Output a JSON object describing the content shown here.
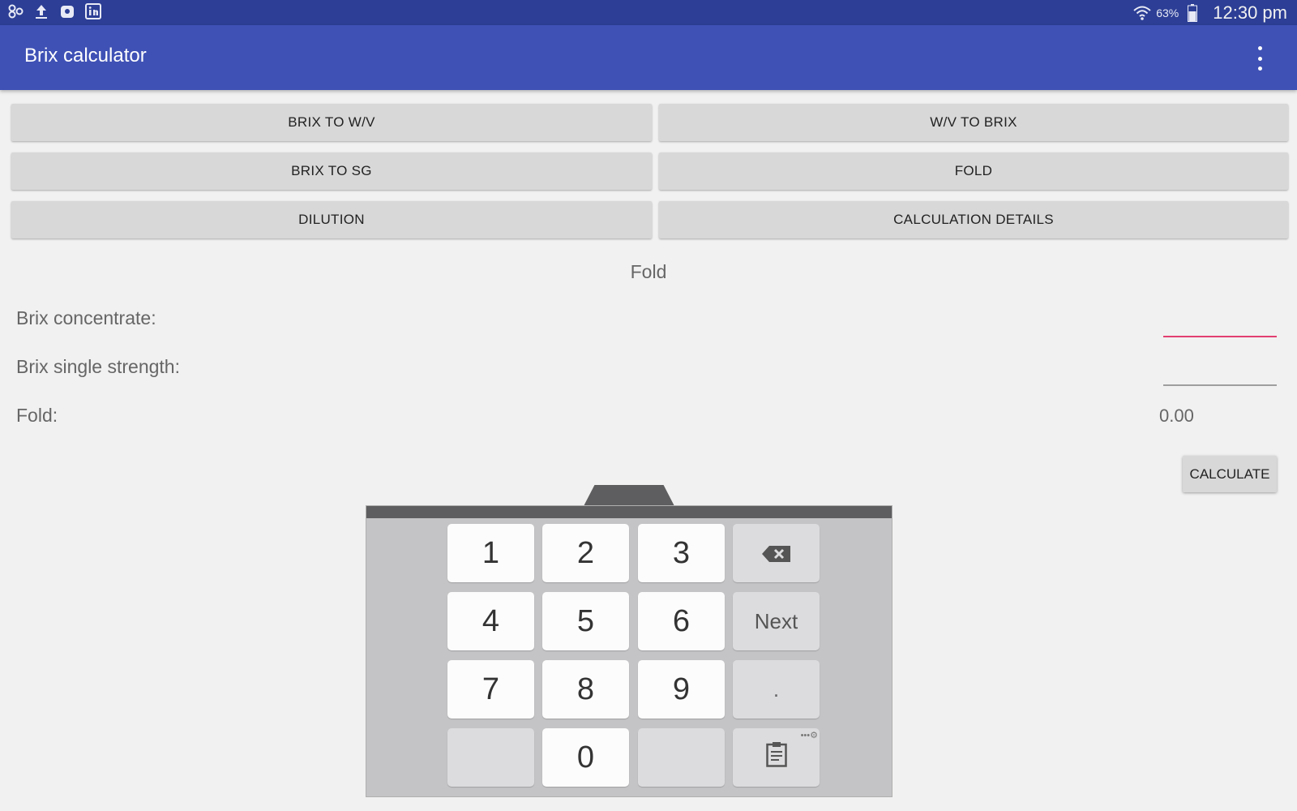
{
  "status_bar": {
    "icons": [
      "notification-app-icon",
      "upload-icon",
      "media-icon",
      "linkedin-icon"
    ],
    "battery": "63%",
    "time": "12:30 pm"
  },
  "app_bar": {
    "title": "Brix calculator"
  },
  "modes": {
    "brix_to_wv": "BRIX TO W/V",
    "wv_to_brix": "W/V TO BRIX",
    "brix_to_sg": "BRIX TO SG",
    "fold": "FOLD",
    "dilution": "DILUTION",
    "calculation_details": "CALCULATION DETAILS"
  },
  "section": {
    "title": "Fold",
    "brix_concentrate_label": "Brix concentrate:",
    "brix_concentrate_value": "",
    "brix_single_strength_label": "Brix single strength:",
    "brix_single_strength_value": "",
    "fold_label": "Fold:",
    "fold_value": "0.00",
    "calculate_label": "CALCULATE"
  },
  "keypad": {
    "k1": "1",
    "k2": "2",
    "k3": "3",
    "k4": "4",
    "k5": "5",
    "k6": "6",
    "k7": "7",
    "k8": "8",
    "k9": "9",
    "k0": "0",
    "next": "Next",
    "dot": "."
  }
}
